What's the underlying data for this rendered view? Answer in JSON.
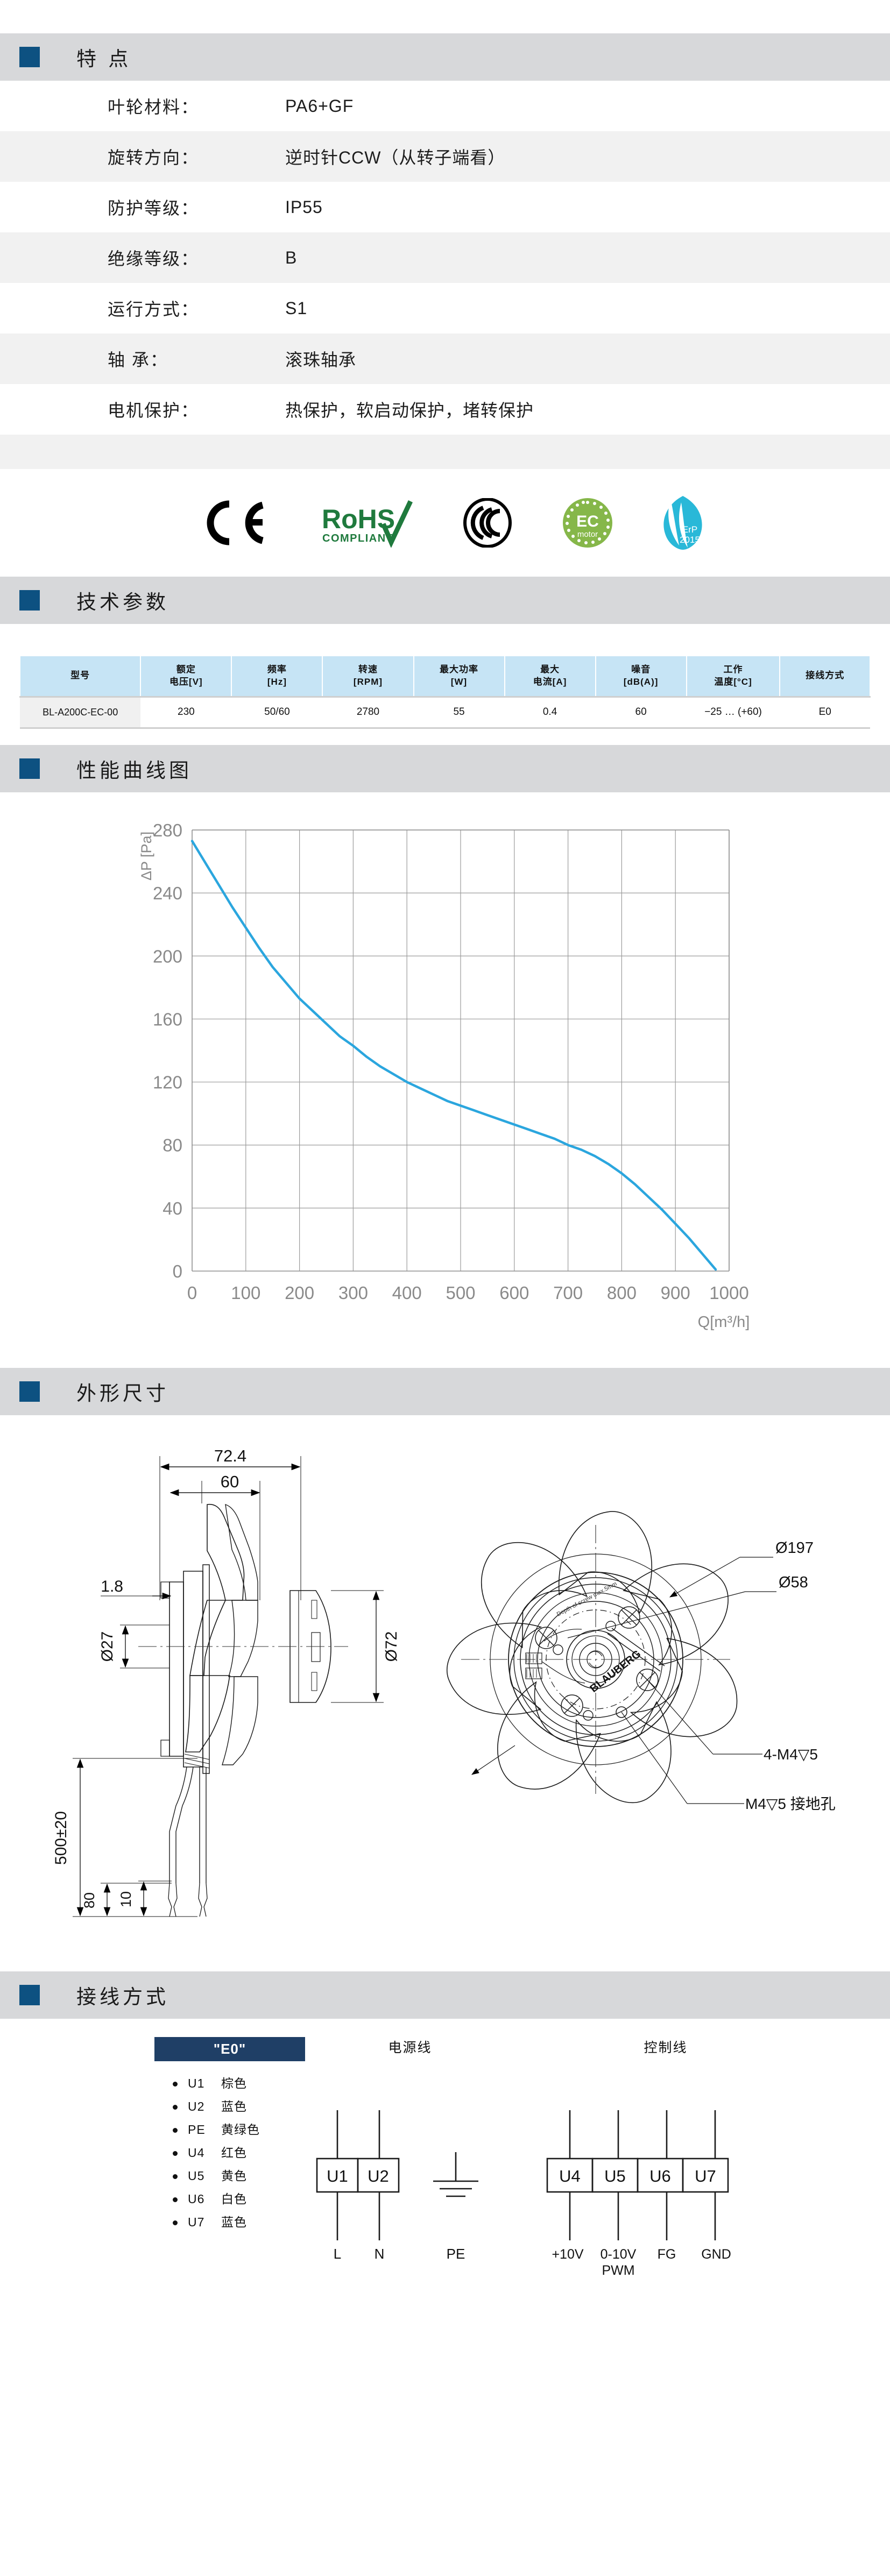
{
  "sections": {
    "features": "特 点",
    "tech": "技术参数",
    "curve": "性能曲线图",
    "dimensions": "外形尺寸",
    "wiring": "接线方式"
  },
  "features": {
    "rows": [
      {
        "key": "叶轮材料：",
        "value": "PA6+GF"
      },
      {
        "key": "旋转方向：",
        "value": "逆时针CCW（从转子端看）"
      },
      {
        "key": "防护等级：",
        "value": "IP55"
      },
      {
        "key": "绝缘等级：",
        "value": "B"
      },
      {
        "key": "运行方式：",
        "value": "S1"
      },
      {
        "key": "轴 承：",
        "value": "滚珠轴承"
      },
      {
        "key": "电机保护：",
        "value": "热保护，软启动保护，堵转保护"
      }
    ]
  },
  "certifications": [
    {
      "name": "ce-mark",
      "label": "CE"
    },
    {
      "name": "rohs-mark",
      "label": "RoHS",
      "sub": "COMPLIANT"
    },
    {
      "name": "ccc-mark",
      "label": "CCC"
    },
    {
      "name": "ec-motor-mark",
      "label": "EC",
      "sub": "motor"
    },
    {
      "name": "erp-mark",
      "label": "ErP",
      "sub": "2015"
    }
  ],
  "tech_table": {
    "headers": [
      "型号",
      "额定\n电压[V]",
      "频率\n[Hz]",
      "转速\n[RPM]",
      "最大功率\n[W]",
      "最大\n电流[A]",
      "噪音\n[dB(A)]",
      "工作\n温度[°C]",
      "接线方式"
    ],
    "rows": [
      [
        "BL-A200C-EC-00",
        "230",
        "50/60",
        "2780",
        "55",
        "0.4",
        "60",
        "−25 … (+60)",
        "E0"
      ]
    ]
  },
  "chart_data": {
    "type": "line",
    "title": "",
    "xlabel": "Q[m³/h]",
    "ylabel": "ΔP [Pa]",
    "xlim": [
      0,
      1000
    ],
    "ylim": [
      0,
      280
    ],
    "xticks": [
      0,
      100,
      200,
      300,
      400,
      500,
      600,
      700,
      800,
      900,
      1000
    ],
    "yticks": [
      0,
      40,
      80,
      120,
      160,
      200,
      240,
      280
    ],
    "grid": true,
    "legend": "none",
    "line_color": "#2ba6de",
    "series": [
      {
        "name": "ΔP",
        "x": [
          0,
          25,
          50,
          75,
          100,
          125,
          150,
          175,
          200,
          225,
          250,
          275,
          300,
          325,
          350,
          375,
          400,
          425,
          450,
          475,
          500,
          525,
          550,
          575,
          600,
          625,
          650,
          675,
          700,
          725,
          750,
          775,
          800,
          825,
          850,
          875,
          900,
          925,
          950,
          975
        ],
        "y": [
          273,
          259,
          245,
          231,
          218,
          205,
          193,
          183,
          173,
          165,
          157,
          149,
          143,
          136,
          130,
          125,
          120,
          116,
          112,
          108,
          105,
          102,
          99,
          96,
          93,
          90,
          87,
          84,
          80,
          77,
          73,
          68,
          62,
          55,
          47,
          39,
          30,
          21,
          11,
          1
        ]
      }
    ]
  },
  "dimensions": {
    "side_view": {
      "overall_depth": "72.4",
      "impeller_depth": "60",
      "flange_thickness": "1.8",
      "hub_bore": "Ø27",
      "motor_dia": "Ø72",
      "cable_length": "500±20",
      "lead_strip": "10",
      "lead_offset": "80"
    },
    "front_view": {
      "outer_dia": "Ø197",
      "bolt_circle": "Ø58",
      "mount_holes": "4-M4▽5",
      "ground_hole": "M4▽5 接地孔",
      "plate_note": "Depth of screw max.5mm",
      "brand": "BLAUBERG"
    }
  },
  "wiring": {
    "variant_label": "\"E0\"",
    "wires": [
      {
        "code": "U1",
        "color": "棕色"
      },
      {
        "code": "U2",
        "color": "蓝色"
      },
      {
        "code": "PE",
        "color": "黄绿色"
      },
      {
        "code": "U4",
        "color": "红色"
      },
      {
        "code": "U5",
        "color": "黄色"
      },
      {
        "code": "U6",
        "color": "白色"
      },
      {
        "code": "U7",
        "color": "蓝色"
      }
    ],
    "power": {
      "title": "电源线",
      "terminals": [
        "U1",
        "U2"
      ],
      "bottom_labels": [
        "L",
        "N"
      ],
      "earth_label": "PE"
    },
    "control": {
      "title": "控制线",
      "terminals": [
        "U4",
        "U5",
        "U6",
        "U7"
      ],
      "bottom_labels": [
        "+10V",
        "0-10V",
        "FG",
        "GND"
      ],
      "bottom_sub": "PWM"
    }
  },
  "colors": {
    "accent": "#0d5181",
    "bar_bg": "#d7d8da",
    "table_header": "#c6e4f5",
    "curve": "#2ba6de",
    "e0_header": "#1f3f66"
  }
}
